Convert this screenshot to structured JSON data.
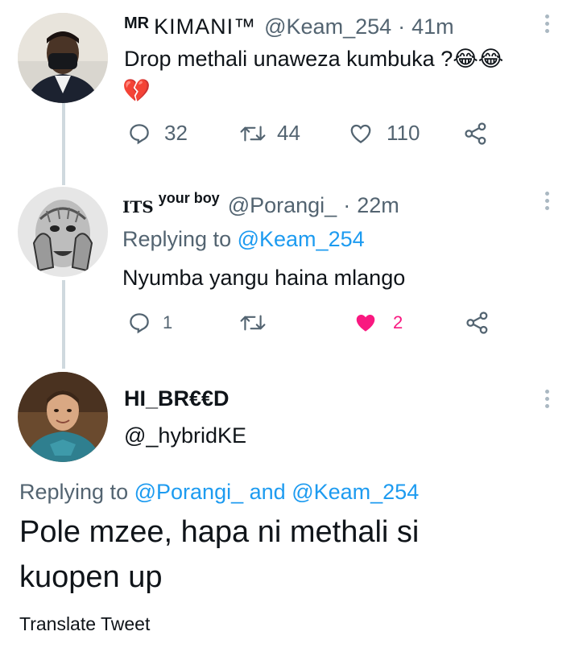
{
  "tweets": [
    {
      "display_name": "MR KIMANI™",
      "name_prefix": "MR",
      "name_main": "KIMANI™",
      "handle": "@Keam_254",
      "separator": "·",
      "time": "41m",
      "text": "Drop methali unaweza kumbuka ?😂😂",
      "emoji_line": "💔",
      "actions": {
        "replies": "32",
        "retweets": "44",
        "likes": "110"
      }
    },
    {
      "display_name": "ITS your boy",
      "name_prefix": "ITS",
      "name_main": "your boy",
      "handle": "@Porangi_",
      "separator": "·",
      "time": "22m",
      "replying_prefix": "Replying to",
      "replying_to": "@Keam_254",
      "text": "Nyumba yangu haina mlango",
      "actions": {
        "replies": "1",
        "retweets": "",
        "likes": "2"
      }
    }
  ],
  "focused": {
    "display_name": "HI_BR€€D",
    "handle": "@_hybridKE",
    "replying_prefix": "Replying to",
    "replying_to_1": "@Porangi_",
    "replying_and": "and",
    "replying_to_2": "@Keam_254",
    "text_line1": "Pole mzee, hapa ni methali si",
    "text_line2": "kuopen up",
    "translate": "Translate Tweet"
  },
  "colors": {
    "accent": "#1d9bf0",
    "like_active": "#f91880",
    "muted": "#536471",
    "thread_line": "#cfd9de"
  },
  "icons": [
    "reply-icon",
    "retweet-icon",
    "like-icon",
    "share-icon",
    "more-icon"
  ]
}
